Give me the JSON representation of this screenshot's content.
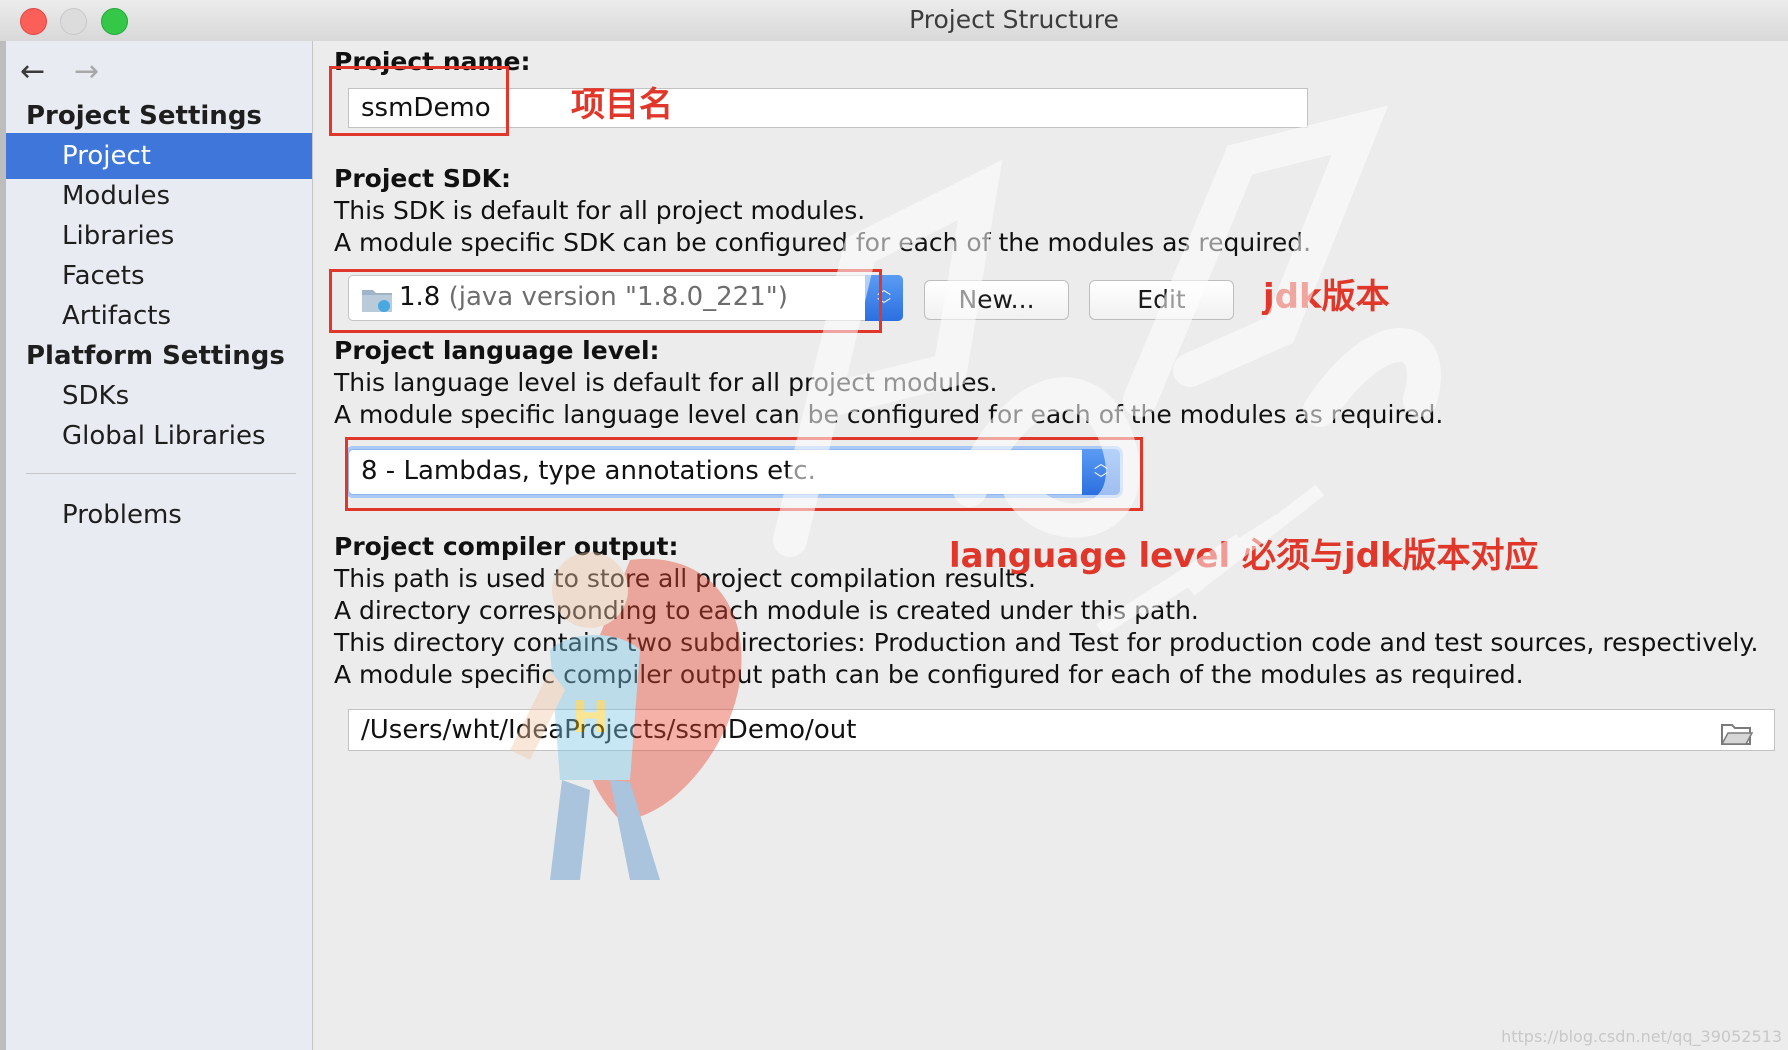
{
  "window": {
    "title": "Project Structure"
  },
  "nav": {
    "back": "←",
    "forward": "→"
  },
  "sidebar": {
    "project_settings_header": "Project Settings",
    "project_items": [
      "Project",
      "Modules",
      "Libraries",
      "Facets",
      "Artifacts"
    ],
    "platform_settings_header": "Platform Settings",
    "platform_items": [
      "SDKs",
      "Global Libraries"
    ],
    "problems": "Problems",
    "selected": "Project"
  },
  "project_name": {
    "label": "Project name:",
    "value": "ssmDemo"
  },
  "sdk": {
    "label": "Project SDK:",
    "desc1": "This SDK is default for all project modules.",
    "desc2": "A module specific SDK can be configured for each of the modules as required.",
    "value_main": "1.8",
    "value_detail": "(java version \"1.8.0_221\")",
    "new_button": "New...",
    "edit_button": "Edit"
  },
  "language_level": {
    "label": "Project language level:",
    "desc1": "This language level is default for all project modules.",
    "desc2": "A module specific language level can be configured for each of the modules as required.",
    "value": "8 - Lambdas, type annotations etc."
  },
  "compiler_output": {
    "label": "Project compiler output:",
    "desc1": "This path is used to store all project compilation results.",
    "desc2": "A directory corresponding to each module is created under this path.",
    "desc3": "This directory contains two subdirectories: Production and Test for production code and test sources, respectively.",
    "desc4": "A module specific compiler output path can be configured for each of the modules as required.",
    "value": "/Users/wht/IdeaProjects/ssmDemo/out"
  },
  "annotations": {
    "project_name": "项目名",
    "jdk_version": "jdk版本",
    "language_level": "language level 必须与jdk版本对应"
  },
  "footer": {
    "watermark_url": "https://blog.csdn.net/qq_39052513"
  },
  "colors": {
    "selection": "#3e77d9",
    "annotation_red": "#e0372a",
    "stepper_blue": "#2c6fe0"
  }
}
